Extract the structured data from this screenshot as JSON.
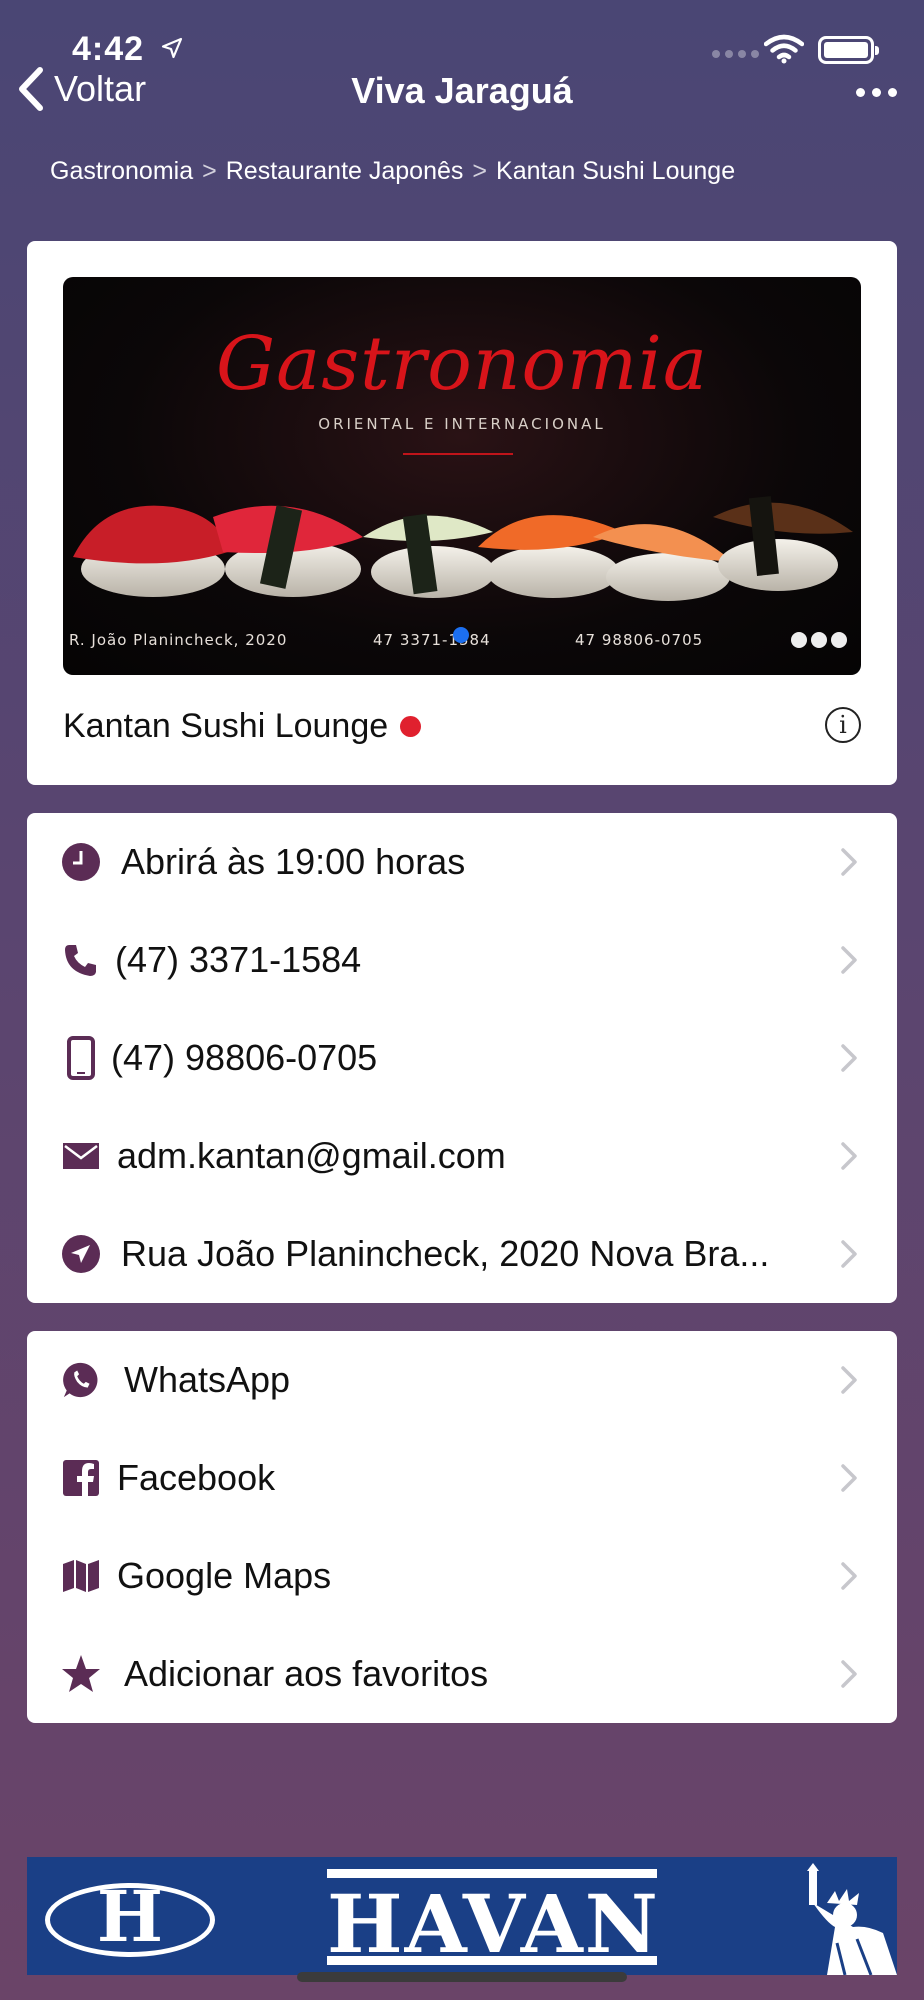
{
  "status_bar": {
    "time": "4:42"
  },
  "nav": {
    "back_label": "Voltar",
    "title": "Viva Jaraguá"
  },
  "breadcrumb": {
    "items": [
      "Gastronomia",
      "Restaurante Japonês",
      "Kantan Sushi Lounge"
    ],
    "separator": ">"
  },
  "hero": {
    "banner": {
      "title": "Gastronomia",
      "subtitle": "ORIENTAL E INTERNACIONAL",
      "address": "R. João Planincheck, 2020",
      "phone": "47 3371-1584",
      "whatsapp": "47 98806-0705"
    },
    "name": "Kantan Sushi Lounge",
    "status_color": "#e0202e",
    "info_icon_glyph": "i"
  },
  "contacts": [
    {
      "icon": "clock-icon",
      "label": "Abrirá às 19:00 horas"
    },
    {
      "icon": "phone-icon",
      "label": "(47) 3371-1584"
    },
    {
      "icon": "mobile-phone-icon",
      "label": "(47) 98806-0705"
    },
    {
      "icon": "email-icon",
      "label": "adm.kantan@gmail.com"
    },
    {
      "icon": "location-arrow-icon",
      "label": "Rua João Planincheck, 2020 Nova Bra..."
    }
  ],
  "links": [
    {
      "icon": "whatsapp-icon",
      "label": "WhatsApp"
    },
    {
      "icon": "facebook-icon",
      "label": "Facebook"
    },
    {
      "icon": "map-icon",
      "label": "Google Maps"
    },
    {
      "icon": "star-icon",
      "label": "Adicionar aos favoritos"
    }
  ],
  "ad": {
    "logo_letter": "H",
    "brand": "HAVAN"
  },
  "colors": {
    "accent": "#5b2c55",
    "chevron": "#c7c7cc",
    "closed_status": "#e0202e",
    "ad_background": "#1a3f86"
  }
}
